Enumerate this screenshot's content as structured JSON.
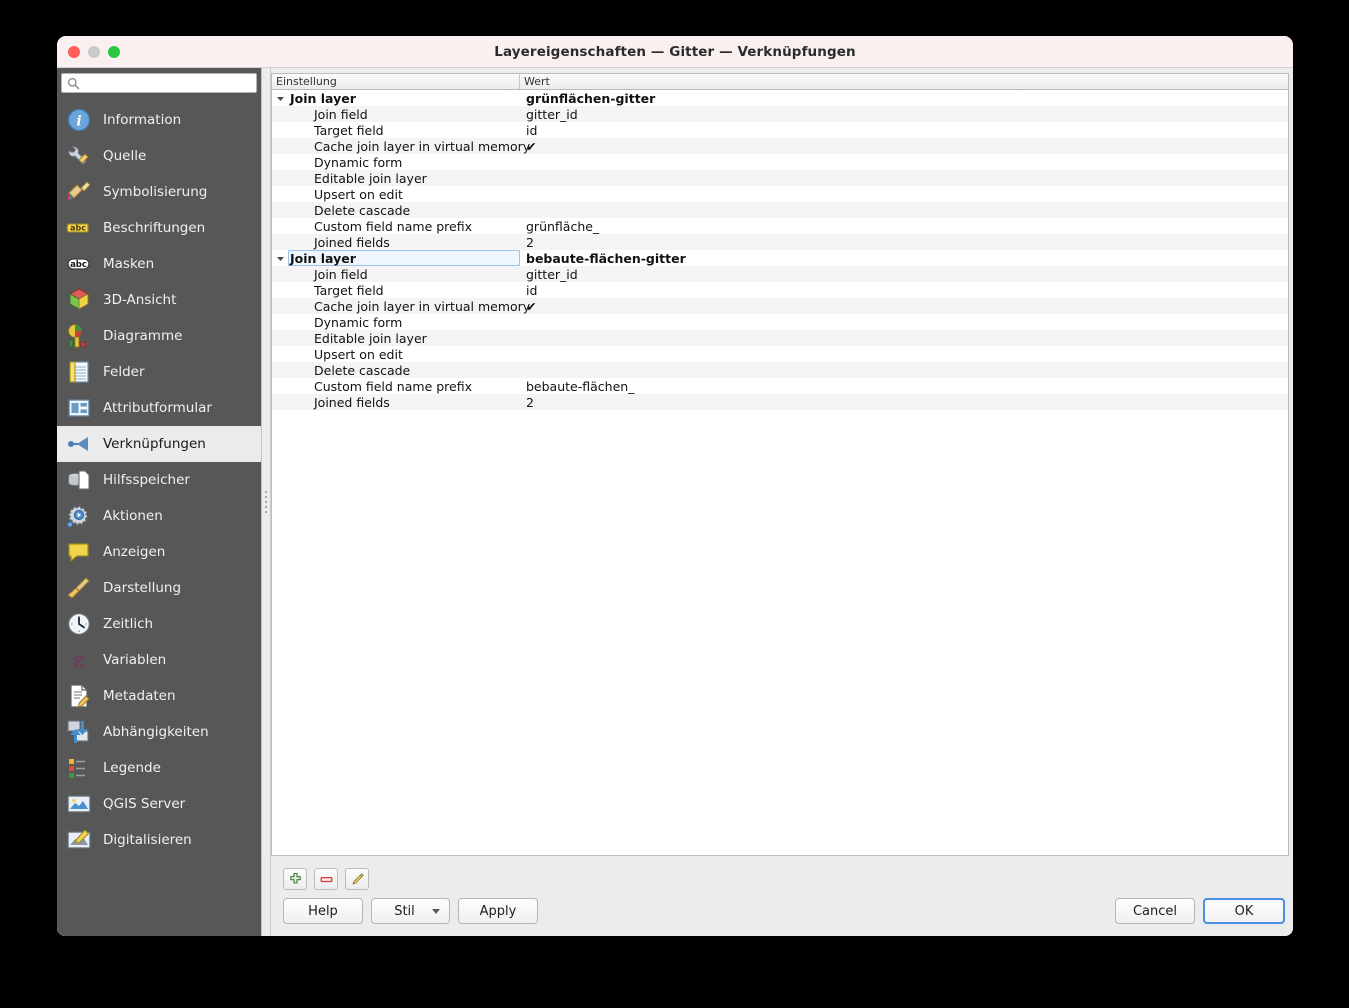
{
  "window": {
    "title": "Layereigenschaften  — Gitter — Verknüpfungen",
    "traffic_lights": [
      "close",
      "minimize",
      "zoom"
    ]
  },
  "search": {
    "value": "",
    "placeholder": "",
    "icon": "search-icon"
  },
  "sidebar": {
    "selected": "Verknüpfungen",
    "items": [
      {
        "label": "Information",
        "icon": "information-icon"
      },
      {
        "label": "Quelle",
        "icon": "source-wrench-icon"
      },
      {
        "label": "Symbolisierung",
        "icon": "symbology-brush-icon"
      },
      {
        "label": "Beschriftungen",
        "icon": "labels-abc-icon"
      },
      {
        "label": "Masken",
        "icon": "masks-abc-icon"
      },
      {
        "label": "3D-Ansicht",
        "icon": "3d-view-cube-icon"
      },
      {
        "label": "Diagramme",
        "icon": "diagrams-chart-icon"
      },
      {
        "label": "Felder",
        "icon": "fields-table-icon"
      },
      {
        "label": "Attributformular",
        "icon": "attribute-form-icon"
      },
      {
        "label": "Verknüpfungen",
        "icon": "joins-icon"
      },
      {
        "label": "Hilfsspeicher",
        "icon": "auxiliary-storage-icon"
      },
      {
        "label": "Aktionen",
        "icon": "actions-gear-icon"
      },
      {
        "label": "Anzeigen",
        "icon": "display-speech-bubble-icon"
      },
      {
        "label": "Darstellung",
        "icon": "rendering-broom-icon"
      },
      {
        "label": "Zeitlich",
        "icon": "temporal-clock-icon"
      },
      {
        "label": "Variablen",
        "icon": "variables-epsilon-icon"
      },
      {
        "label": "Metadaten",
        "icon": "metadata-document-icon"
      },
      {
        "label": "Abhängigkeiten",
        "icon": "dependencies-arrows-icon"
      },
      {
        "label": "Legende",
        "icon": "legend-icon"
      },
      {
        "label": "QGIS Server",
        "icon": "qgis-server-icon"
      },
      {
        "label": "Digitalisieren",
        "icon": "digitizing-pencil-icon"
      }
    ]
  },
  "tree": {
    "columns": [
      "Einstellung",
      "Wert"
    ],
    "rows": [
      {
        "setting": "Join layer",
        "value": "grünflächen-gitter",
        "type": "group",
        "expanded": true,
        "selected": false
      },
      {
        "setting": "Join field",
        "value": "gitter_id",
        "type": "child"
      },
      {
        "setting": "Target field",
        "value": "id",
        "type": "child"
      },
      {
        "setting": "Cache join layer in virtual memory",
        "value": "✔",
        "type": "child"
      },
      {
        "setting": "Dynamic form",
        "value": "",
        "type": "child"
      },
      {
        "setting": "Editable join layer",
        "value": "",
        "type": "child"
      },
      {
        "setting": "Upsert on edit",
        "value": "",
        "type": "child"
      },
      {
        "setting": "Delete cascade",
        "value": "",
        "type": "child"
      },
      {
        "setting": "Custom field name prefix",
        "value": "grünfläche_",
        "type": "child"
      },
      {
        "setting": "Joined fields",
        "value": "2",
        "type": "child"
      },
      {
        "setting": "Join layer",
        "value": "bebaute-flächen-gitter",
        "type": "group",
        "expanded": true,
        "selected": true
      },
      {
        "setting": "Join field",
        "value": "gitter_id",
        "type": "child"
      },
      {
        "setting": "Target field",
        "value": "id",
        "type": "child"
      },
      {
        "setting": "Cache join layer in virtual memory",
        "value": "✔",
        "type": "child"
      },
      {
        "setting": "Dynamic form",
        "value": "",
        "type": "child"
      },
      {
        "setting": "Editable join layer",
        "value": "",
        "type": "child"
      },
      {
        "setting": "Upsert on edit",
        "value": "",
        "type": "child"
      },
      {
        "setting": "Delete cascade",
        "value": "",
        "type": "child"
      },
      {
        "setting": "Custom field name prefix",
        "value": "bebaute-flächen_",
        "type": "child"
      },
      {
        "setting": "Joined fields",
        "value": "2",
        "type": "child"
      }
    ]
  },
  "toolbar": {
    "add": {
      "name": "add-join-button",
      "icon": "green-plus-icon"
    },
    "remove": {
      "name": "remove-join-button",
      "icon": "red-minus-icon"
    },
    "edit": {
      "name": "edit-join-button",
      "icon": "yellow-pencil-icon"
    }
  },
  "buttons": {
    "help": "Help",
    "style": "Stil",
    "apply": "Apply",
    "cancel": "Cancel",
    "ok": "OK"
  },
  "colors": {
    "sidebar_bg": "#575757",
    "titlebar_bg": "#faf0f0",
    "selected_row": "#ebebeb",
    "alt_row": "#f4f4f4",
    "default_button_outline": "#4a90e2",
    "selection_box": "#9fc3e8"
  }
}
